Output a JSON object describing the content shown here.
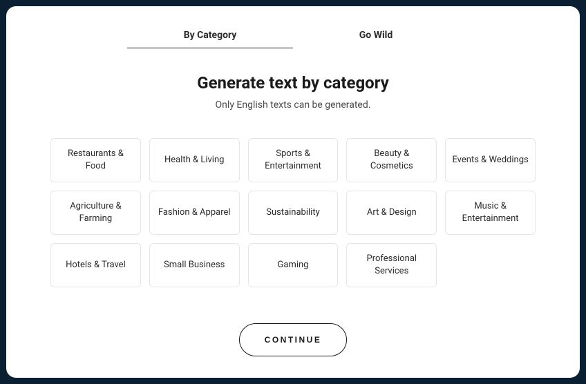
{
  "tabs": {
    "byCategory": "By Category",
    "goWild": "Go Wild"
  },
  "header": {
    "title": "Generate text by category",
    "subtitle": "Only English texts can be generated."
  },
  "categories": [
    "Restaurants & Food",
    "Health & Living",
    "Sports & Entertainment",
    "Beauty & Cosmetics",
    "Events & Weddings",
    "Agriculture & Farming",
    "Fashion & Apparel",
    "Sustainability",
    "Art & Design",
    "Music & Entertainment",
    "Hotels & Travel",
    "Small Business",
    "Gaming",
    "Professional Services"
  ],
  "footer": {
    "continue": "CONTINUE"
  }
}
